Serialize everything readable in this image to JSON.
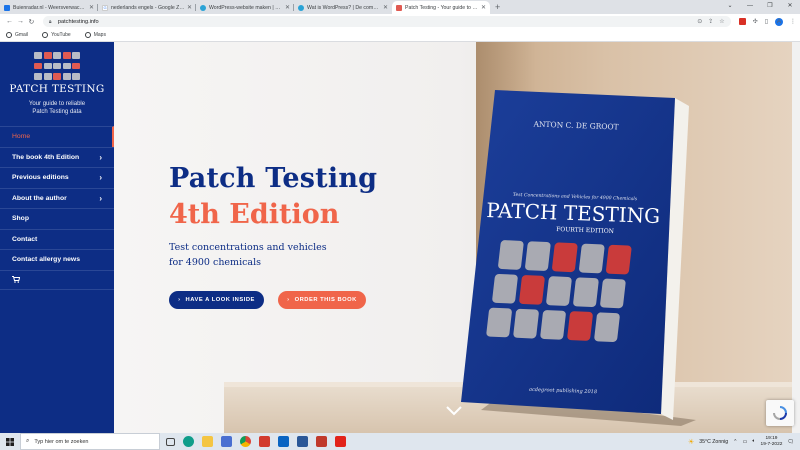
{
  "browser": {
    "tabs": [
      {
        "title": "Buienradar.nl - Weersverwachting",
        "color": "#1a73e8",
        "active": false
      },
      {
        "title": "nederlands engels - Google Zoeken",
        "color": "#4285f4",
        "active": false
      },
      {
        "title": "WordPress-website maken | Bou",
        "color": "#2aa3d6",
        "active": false
      },
      {
        "title": "Wat is WordPress? | De complete",
        "color": "#2aa3d6",
        "active": false
      },
      {
        "title": "Patch Testing - Your guide to reli",
        "color": "#e05a52",
        "active": true
      }
    ],
    "url": "patchtesting.info",
    "bookmarks": [
      "Gmail",
      "YouTube",
      "Maps"
    ],
    "profile_initial": "A"
  },
  "site": {
    "brand": "PATCH TESTING",
    "tagline_line1": "Your guide to reliable",
    "tagline_line2": "Patch Testing data",
    "menu": [
      {
        "label": "Home",
        "active": true,
        "has_children": false
      },
      {
        "label": "The book 4th Edition",
        "active": false,
        "has_children": true
      },
      {
        "label": "Previous editions",
        "active": false,
        "has_children": true
      },
      {
        "label": "About the author",
        "active": false,
        "has_children": true
      },
      {
        "label": "Shop",
        "active": false,
        "has_children": false
      },
      {
        "label": "Contact",
        "active": false,
        "has_children": false
      },
      {
        "label": "Contact allergy news",
        "active": false,
        "has_children": false
      }
    ],
    "cart_icon": "cart-icon"
  },
  "hero": {
    "title_line1": "Patch Testing",
    "title_line2": "4th Edition",
    "subtitle_line1": "Test concentrations and vehicles",
    "subtitle_line2": "for 4900 chemicals",
    "btn_inside": "HAVE A LOOK INSIDE",
    "btn_order": "ORDER THIS BOOK",
    "colors": {
      "navy": "#0d2d85",
      "coral": "#f0654a"
    }
  },
  "book": {
    "author": "ANTON C. DE GROOT",
    "kicker": "Test Concentrations and Vehicles for 4900 Chemicals",
    "title": "PATCH TESTING",
    "edition": "FOURTH EDITION",
    "publisher": "acdegroot publishing 2018"
  },
  "taskbar": {
    "search_placeholder": "Typ hier om te zoeken",
    "weather": "35°C  Zonnig",
    "time": "19:19",
    "date": "19-7-2022"
  }
}
